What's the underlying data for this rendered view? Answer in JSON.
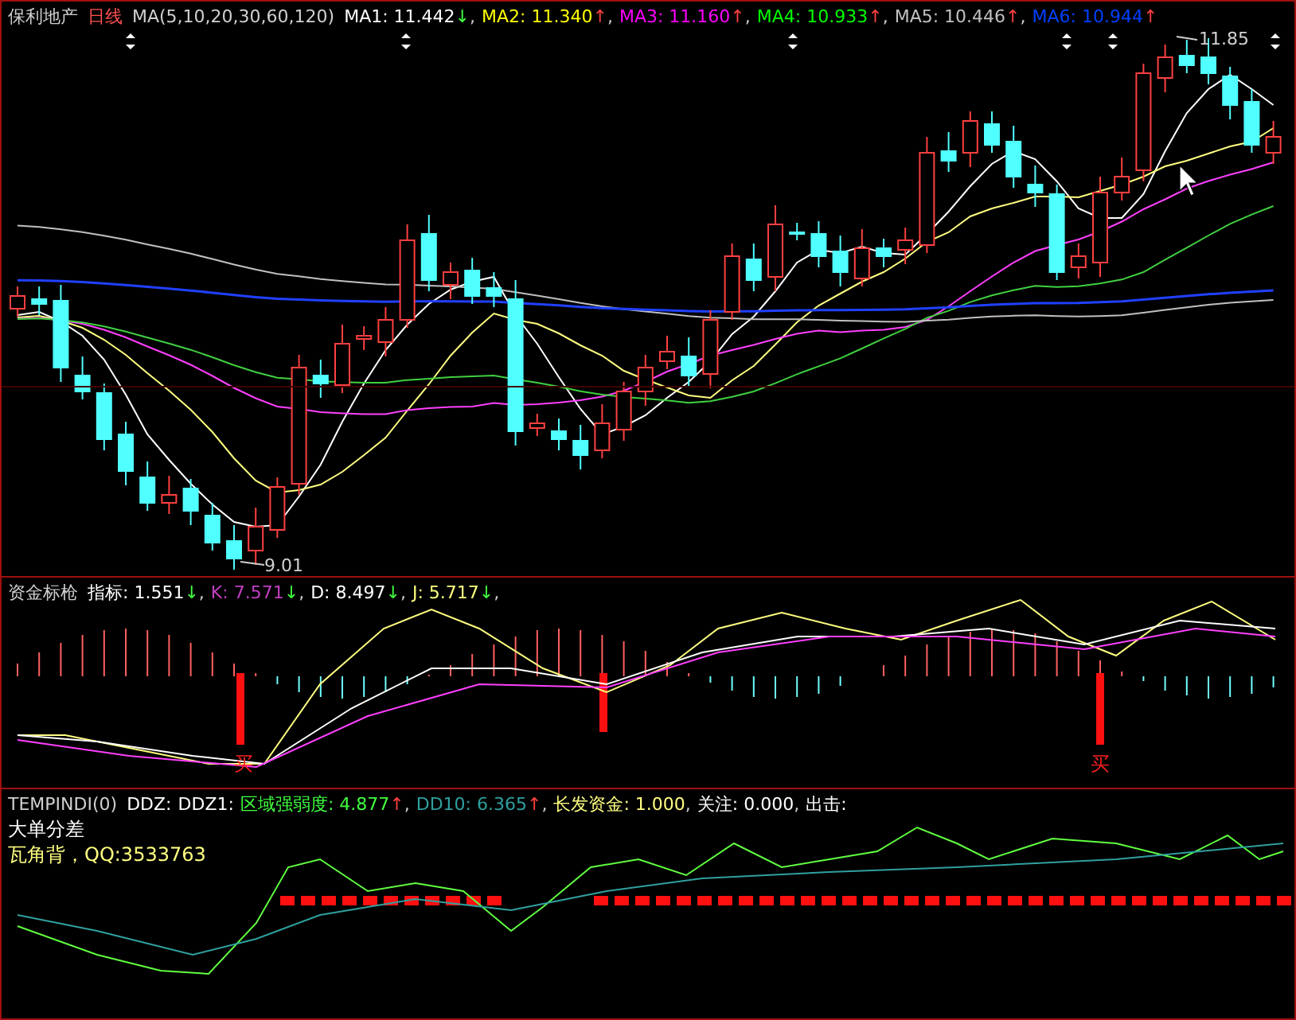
{
  "main_panel": {
    "stock_name": "保利地产",
    "period": "日线",
    "indicator": "MA(5,10,20,30,60,120)",
    "legend": [
      {
        "text": "MA1: 11.442",
        "arrow": {
          "text": "↓",
          "color": "#40ff40"
        },
        "separator": ",",
        "color": "#ffffff"
      },
      {
        "text": "MA2: 11.340",
        "arrow": {
          "text": "↑",
          "color": "#ff4040"
        },
        "separator": ",",
        "color": "#ffff00"
      },
      {
        "text": "MA3: 11.160",
        "arrow": {
          "text": "↑",
          "color": "#ff4040"
        },
        "separator": ",",
        "color": "#ff00ff"
      },
      {
        "text": "MA4: 10.933",
        "arrow": {
          "text": "↑",
          "color": "#ff4040"
        },
        "separator": ",",
        "color": "#00ff00"
      },
      {
        "text": "MA5: 10.446",
        "arrow": {
          "text": "↑",
          "color": "#ff4040"
        },
        "separator": ",",
        "color": "#c0c0c0"
      },
      {
        "text": "MA6: 10.944",
        "arrow": {
          "text": "↑",
          "color": "#ff4040"
        },
        "color": "#0040ff"
      }
    ],
    "high_label": "11.85",
    "low_label": "9.01"
  },
  "fund_panel": {
    "title": "资金标枪",
    "legend": [
      {
        "text": "指标: 1.551",
        "arrow": {
          "text": "↓",
          "color": "#40ff40"
        },
        "separator": ",",
        "color": "#ffffff"
      },
      {
        "text": "K: 7.571",
        "arrow": {
          "text": "↓",
          "color": "#40ff40"
        },
        "separator": ",",
        "color": "#c040c0"
      },
      {
        "text": "D: 8.497",
        "arrow": {
          "text": "↓",
          "color": "#40ff40"
        },
        "separator": ",",
        "color": "#ffffff"
      },
      {
        "text": "J: 5.717",
        "arrow": {
          "text": "↓",
          "color": "#40ff40"
        },
        "separator": ",",
        "color": "#ffff80"
      }
    ],
    "buy_signals": [
      "买",
      "买"
    ]
  },
  "tempindi_panel": {
    "title": "TEMPINDI(0)",
    "legend": [
      {
        "text": "DDZ:",
        "color": "#ffffff"
      },
      {
        "text": "DDZ1:",
        "color": "#ffffff"
      },
      {
        "text": "区域强弱度: 4.877",
        "arrow": {
          "text": "↑",
          "color": "#ff4040"
        },
        "separator": ",",
        "color": "#40ff40"
      },
      {
        "text": "DD10: 6.365",
        "arrow": {
          "text": "↑",
          "color": "#ff4040"
        },
        "separator": ",",
        "color": "#30a0a0"
      },
      {
        "text": "长发资金: 1.000",
        "separator": ",",
        "color": "#ffff80"
      },
      {
        "text": "关注: 0.000",
        "separator": ",",
        "color": "#ffffff"
      },
      {
        "text": "出击:",
        "color": "#ffffff"
      }
    ],
    "line_2": "大单分差",
    "line_3": "瓦角背，QQ:3533763"
  }
}
